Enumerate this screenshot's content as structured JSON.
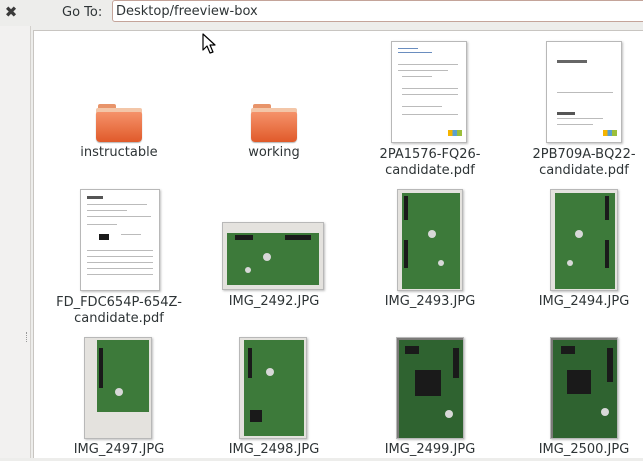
{
  "toolbar": {
    "close_icon": "close-x-icon",
    "goto_label": "Go To:",
    "path_value": "Desktop/freeview-box"
  },
  "files": [
    {
      "name": "instructable",
      "type": "folder"
    },
    {
      "name": "working",
      "type": "folder"
    },
    {
      "name": "2PA1576-FQ26-candidate.pdf",
      "line1": "2PA1576-FQ26-",
      "line2": "candidate.pdf",
      "type": "pdf"
    },
    {
      "name": "2PB709A-BQ22-candidate.pdf",
      "line1": "2PB709A-BQ22-",
      "line2": "candidate.pdf",
      "type": "pdf"
    },
    {
      "name": "FD_FDC654P-654Z-candidate.pdf",
      "line1": "FD_FDC654P-654Z-",
      "line2": "candidate.pdf",
      "type": "pdf"
    },
    {
      "name": "IMG_2492.JPG",
      "type": "image"
    },
    {
      "name": "IMG_2493.JPG",
      "type": "image"
    },
    {
      "name": "IMG_2494.JPG",
      "type": "image"
    },
    {
      "name": "IMG_2497.JPG",
      "type": "image"
    },
    {
      "name": "IMG_2498.JPG",
      "type": "image"
    },
    {
      "name": "IMG_2499.JPG",
      "type": "image"
    },
    {
      "name": "IMG_2500.JPG",
      "type": "image"
    }
  ],
  "colors": {
    "folder_orange": "#e86a3a",
    "pcb_green": "#3d7a3a",
    "input_border": "#c4a49a"
  }
}
